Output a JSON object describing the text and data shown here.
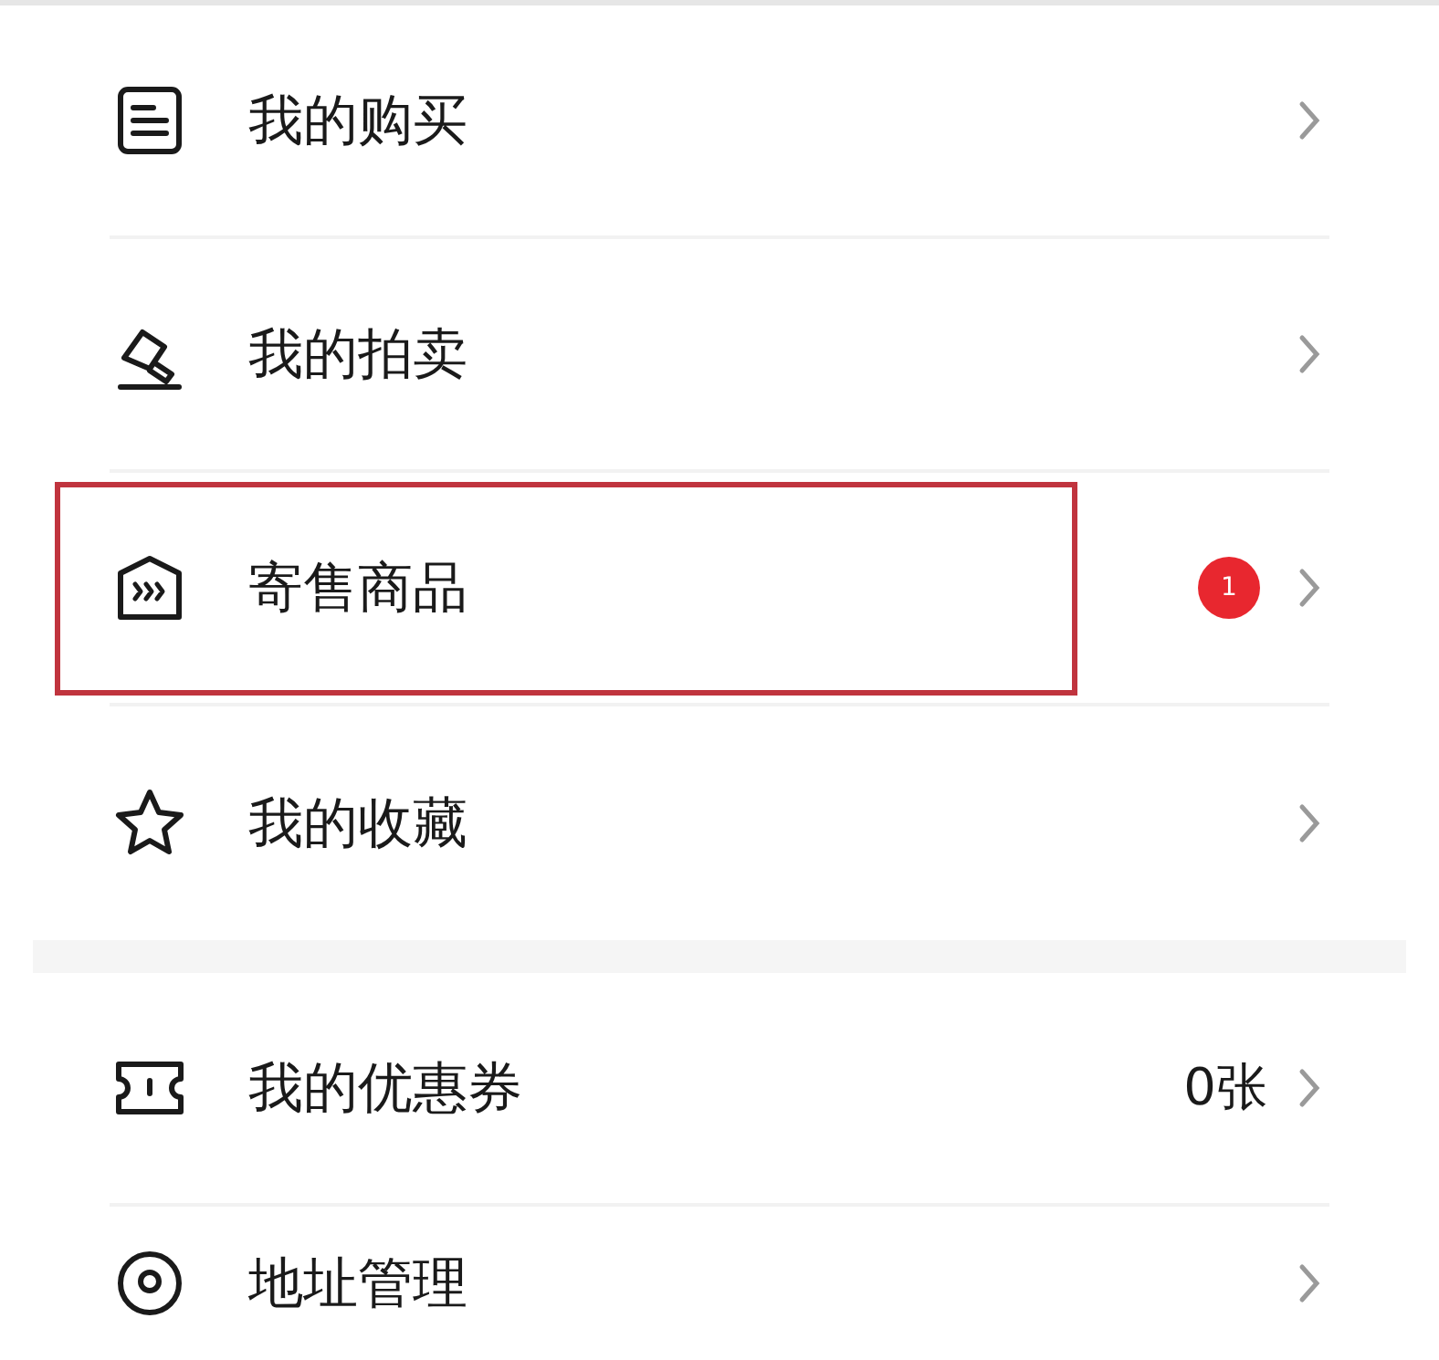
{
  "sections": [
    {
      "items": [
        {
          "label": "我的购买",
          "highlighted": false
        },
        {
          "label": "我的拍卖",
          "highlighted": false
        },
        {
          "label": "寄售商品",
          "badge": "1",
          "highlighted": true
        },
        {
          "label": "我的收藏",
          "highlighted": false
        }
      ]
    },
    {
      "items": [
        {
          "label": "我的优惠券",
          "value": "0张",
          "highlighted": false
        },
        {
          "label": "地址管理",
          "highlighted": false
        }
      ]
    }
  ]
}
